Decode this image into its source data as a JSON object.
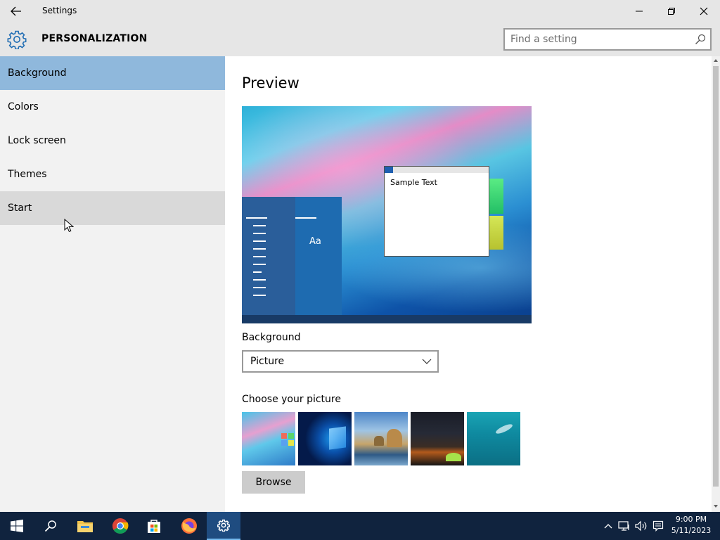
{
  "window": {
    "title": "Settings",
    "back_icon": "back-arrow-icon",
    "controls": [
      "minimize-icon",
      "maximize-icon",
      "close-icon"
    ]
  },
  "header": {
    "section_title": "PERSONALIZATION",
    "icon": "gear-icon",
    "search_placeholder": "Find a setting",
    "search_value": ""
  },
  "sidebar": {
    "items": [
      {
        "label": "Background",
        "state": "selected"
      },
      {
        "label": "Colors",
        "state": "normal"
      },
      {
        "label": "Lock screen",
        "state": "normal"
      },
      {
        "label": "Themes",
        "state": "normal"
      },
      {
        "label": "Start",
        "state": "hover"
      }
    ]
  },
  "main": {
    "preview_heading": "Preview",
    "preview_sample_text": "Sample Text",
    "preview_tile_text": "Aa",
    "background_label": "Background",
    "background_selected": "Picture",
    "choose_label": "Choose your picture",
    "thumbnails": [
      "bloom-wallpaper",
      "windows-logo-wallpaper",
      "beach-rocks-wallpaper",
      "night-sky-tent-wallpaper",
      "underwater-swimmer-wallpaper"
    ],
    "browse_label": "Browse"
  },
  "taskbar": {
    "apps": [
      "start-icon",
      "search-icon",
      "file-explorer-icon",
      "chrome-icon",
      "store-icon",
      "firefox-icon",
      "settings-icon"
    ],
    "active_app": "settings-icon",
    "time": "9:00 PM",
    "date": "5/11/2023"
  },
  "colors": {
    "accent_selected": "#8fb8dc",
    "taskbar": "#10233e",
    "chrome_bg": "#e6e6e6"
  }
}
